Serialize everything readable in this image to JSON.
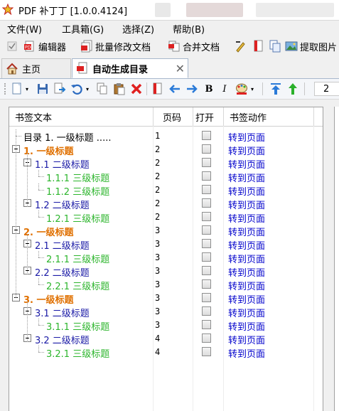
{
  "window": {
    "title": "PDF 补丁丁 [1.0.0.4124]"
  },
  "menu": [
    "文件(W)",
    "工具箱(G)",
    "选择(Z)",
    "帮助(B)"
  ],
  "toolbar": {
    "editor_label": "编辑器",
    "batch_label": "批量修改文档",
    "merge_label": "合并文档",
    "extract_label": "提取图片"
  },
  "tabs": [
    {
      "label": "主页"
    },
    {
      "label": "自动生成目录"
    }
  ],
  "page_number": "2",
  "columns": [
    "书签文本",
    "页码",
    "打开",
    "书签动作"
  ],
  "rows": [
    {
      "text": "目录 1. 一级标题 .....",
      "page": "1",
      "action": "转到页面",
      "level": 0,
      "color": "#000000",
      "bold": false,
      "expander": false
    },
    {
      "text": "1. 一级标题",
      "page": "2",
      "action": "转到页面",
      "level": 0,
      "color": "#e07000",
      "bold": true,
      "expander": true
    },
    {
      "text": "1.1 二级标题",
      "page": "2",
      "action": "转到页面",
      "level": 1,
      "color": "#1a1aa6",
      "bold": false,
      "expander": true
    },
    {
      "text": "1.1.1 三级标题",
      "page": "2",
      "action": "转到页面",
      "level": 2,
      "color": "#2cb52c",
      "bold": false,
      "expander": false
    },
    {
      "text": "1.1.2 三级标题",
      "page": "2",
      "action": "转到页面",
      "level": 2,
      "color": "#2cb52c",
      "bold": false,
      "expander": false
    },
    {
      "text": "1.2 二级标题",
      "page": "2",
      "action": "转到页面",
      "level": 1,
      "color": "#1a1aa6",
      "bold": false,
      "expander": true
    },
    {
      "text": "1.2.1 三级标题",
      "page": "2",
      "action": "转到页面",
      "level": 2,
      "color": "#2cb52c",
      "bold": false,
      "expander": false
    },
    {
      "text": "2. 一级标题",
      "page": "3",
      "action": "转到页面",
      "level": 0,
      "color": "#e07000",
      "bold": true,
      "expander": true
    },
    {
      "text": "2.1 二级标题",
      "page": "3",
      "action": "转到页面",
      "level": 1,
      "color": "#1a1aa6",
      "bold": false,
      "expander": true
    },
    {
      "text": "2.1.1 三级标题",
      "page": "3",
      "action": "转到页面",
      "level": 2,
      "color": "#2cb52c",
      "bold": false,
      "expander": false
    },
    {
      "text": "2.2 二级标题",
      "page": "3",
      "action": "转到页面",
      "level": 1,
      "color": "#1a1aa6",
      "bold": false,
      "expander": true
    },
    {
      "text": "2.2.1 三级标题",
      "page": "3",
      "action": "转到页面",
      "level": 2,
      "color": "#2cb52c",
      "bold": false,
      "expander": false
    },
    {
      "text": "3. 一级标题",
      "page": "3",
      "action": "转到页面",
      "level": 0,
      "color": "#e07000",
      "bold": true,
      "expander": true
    },
    {
      "text": "3.1 二级标题",
      "page": "3",
      "action": "转到页面",
      "level": 1,
      "color": "#1a1aa6",
      "bold": false,
      "expander": true
    },
    {
      "text": "3.1.1 三级标题",
      "page": "3",
      "action": "转到页面",
      "level": 2,
      "color": "#2cb52c",
      "bold": false,
      "expander": false
    },
    {
      "text": "3.2 二级标题",
      "page": "4",
      "action": "转到页面",
      "level": 1,
      "color": "#1a1aa6",
      "bold": false,
      "expander": true
    },
    {
      "text": "3.2.1 三级标题",
      "page": "4",
      "action": "转到页面",
      "level": 2,
      "color": "#2cb52c",
      "bold": false,
      "expander": false
    }
  ]
}
